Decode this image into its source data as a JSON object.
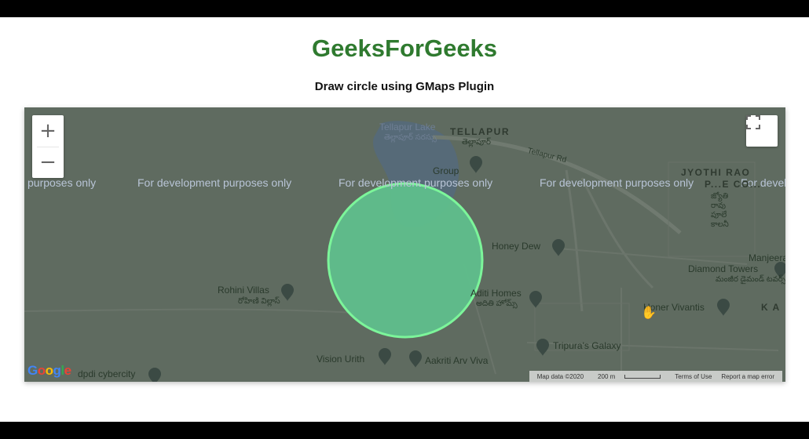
{
  "header": {
    "title": "GeeksForGeeks",
    "subtitle": "Draw circle using GMaps Plugin"
  },
  "map": {
    "watermark": [
      "purposes only",
      "For development purposes only",
      "For development purposes only",
      "For development purposes only",
      "For develo"
    ],
    "zoom_in_label": "+",
    "zoom_out_label": "−",
    "fullscreen_icon": "fullscreen-icon",
    "circle_color": "#6fe8a0",
    "areas": {
      "tellapur": "TELLAPUR",
      "tellapur_te": "తెల్లాపూర్",
      "jyothi": "JYOTHI RAO",
      "jyothi2": "P...E CO...",
      "jyothi_te": "జ్యోతి రావు పూలే కాలనీ",
      "ka": "K A"
    },
    "places": {
      "tellapur_lake": "Tellapur Lake",
      "tellapur_lake_te": "తెల్లాపూర్ సరస్సు",
      "group": "Group",
      "honey_dew": "Honey Dew",
      "rohini_villas": "Rohini Villas",
      "rohini_villas_te": "రోహిణి విల్లాస్",
      "aditi_homes": "Aditi Homes",
      "aditi_homes_te": "అదితి హోమ్స్",
      "manjeera": "Manjeera",
      "diamond_towers": "Diamond Towers",
      "diamond_te": "మంజీర డైమండ్ టవర్స్",
      "honer_vivantis": "Honer Vivantis",
      "tripura_galaxy": "Tripura's Galaxy",
      "vision_urith": "Vision Urith",
      "aakriti": "Aakriti Arv Viva",
      "cybercity": "dpdi cybercity",
      "tellapur_rd": "Tellapur Rd"
    },
    "google_logo": "Google",
    "attribution": {
      "map_data": "Map data ©2020",
      "scale": "200 m",
      "terms": "Terms of Use",
      "report": "Report a map error"
    }
  }
}
